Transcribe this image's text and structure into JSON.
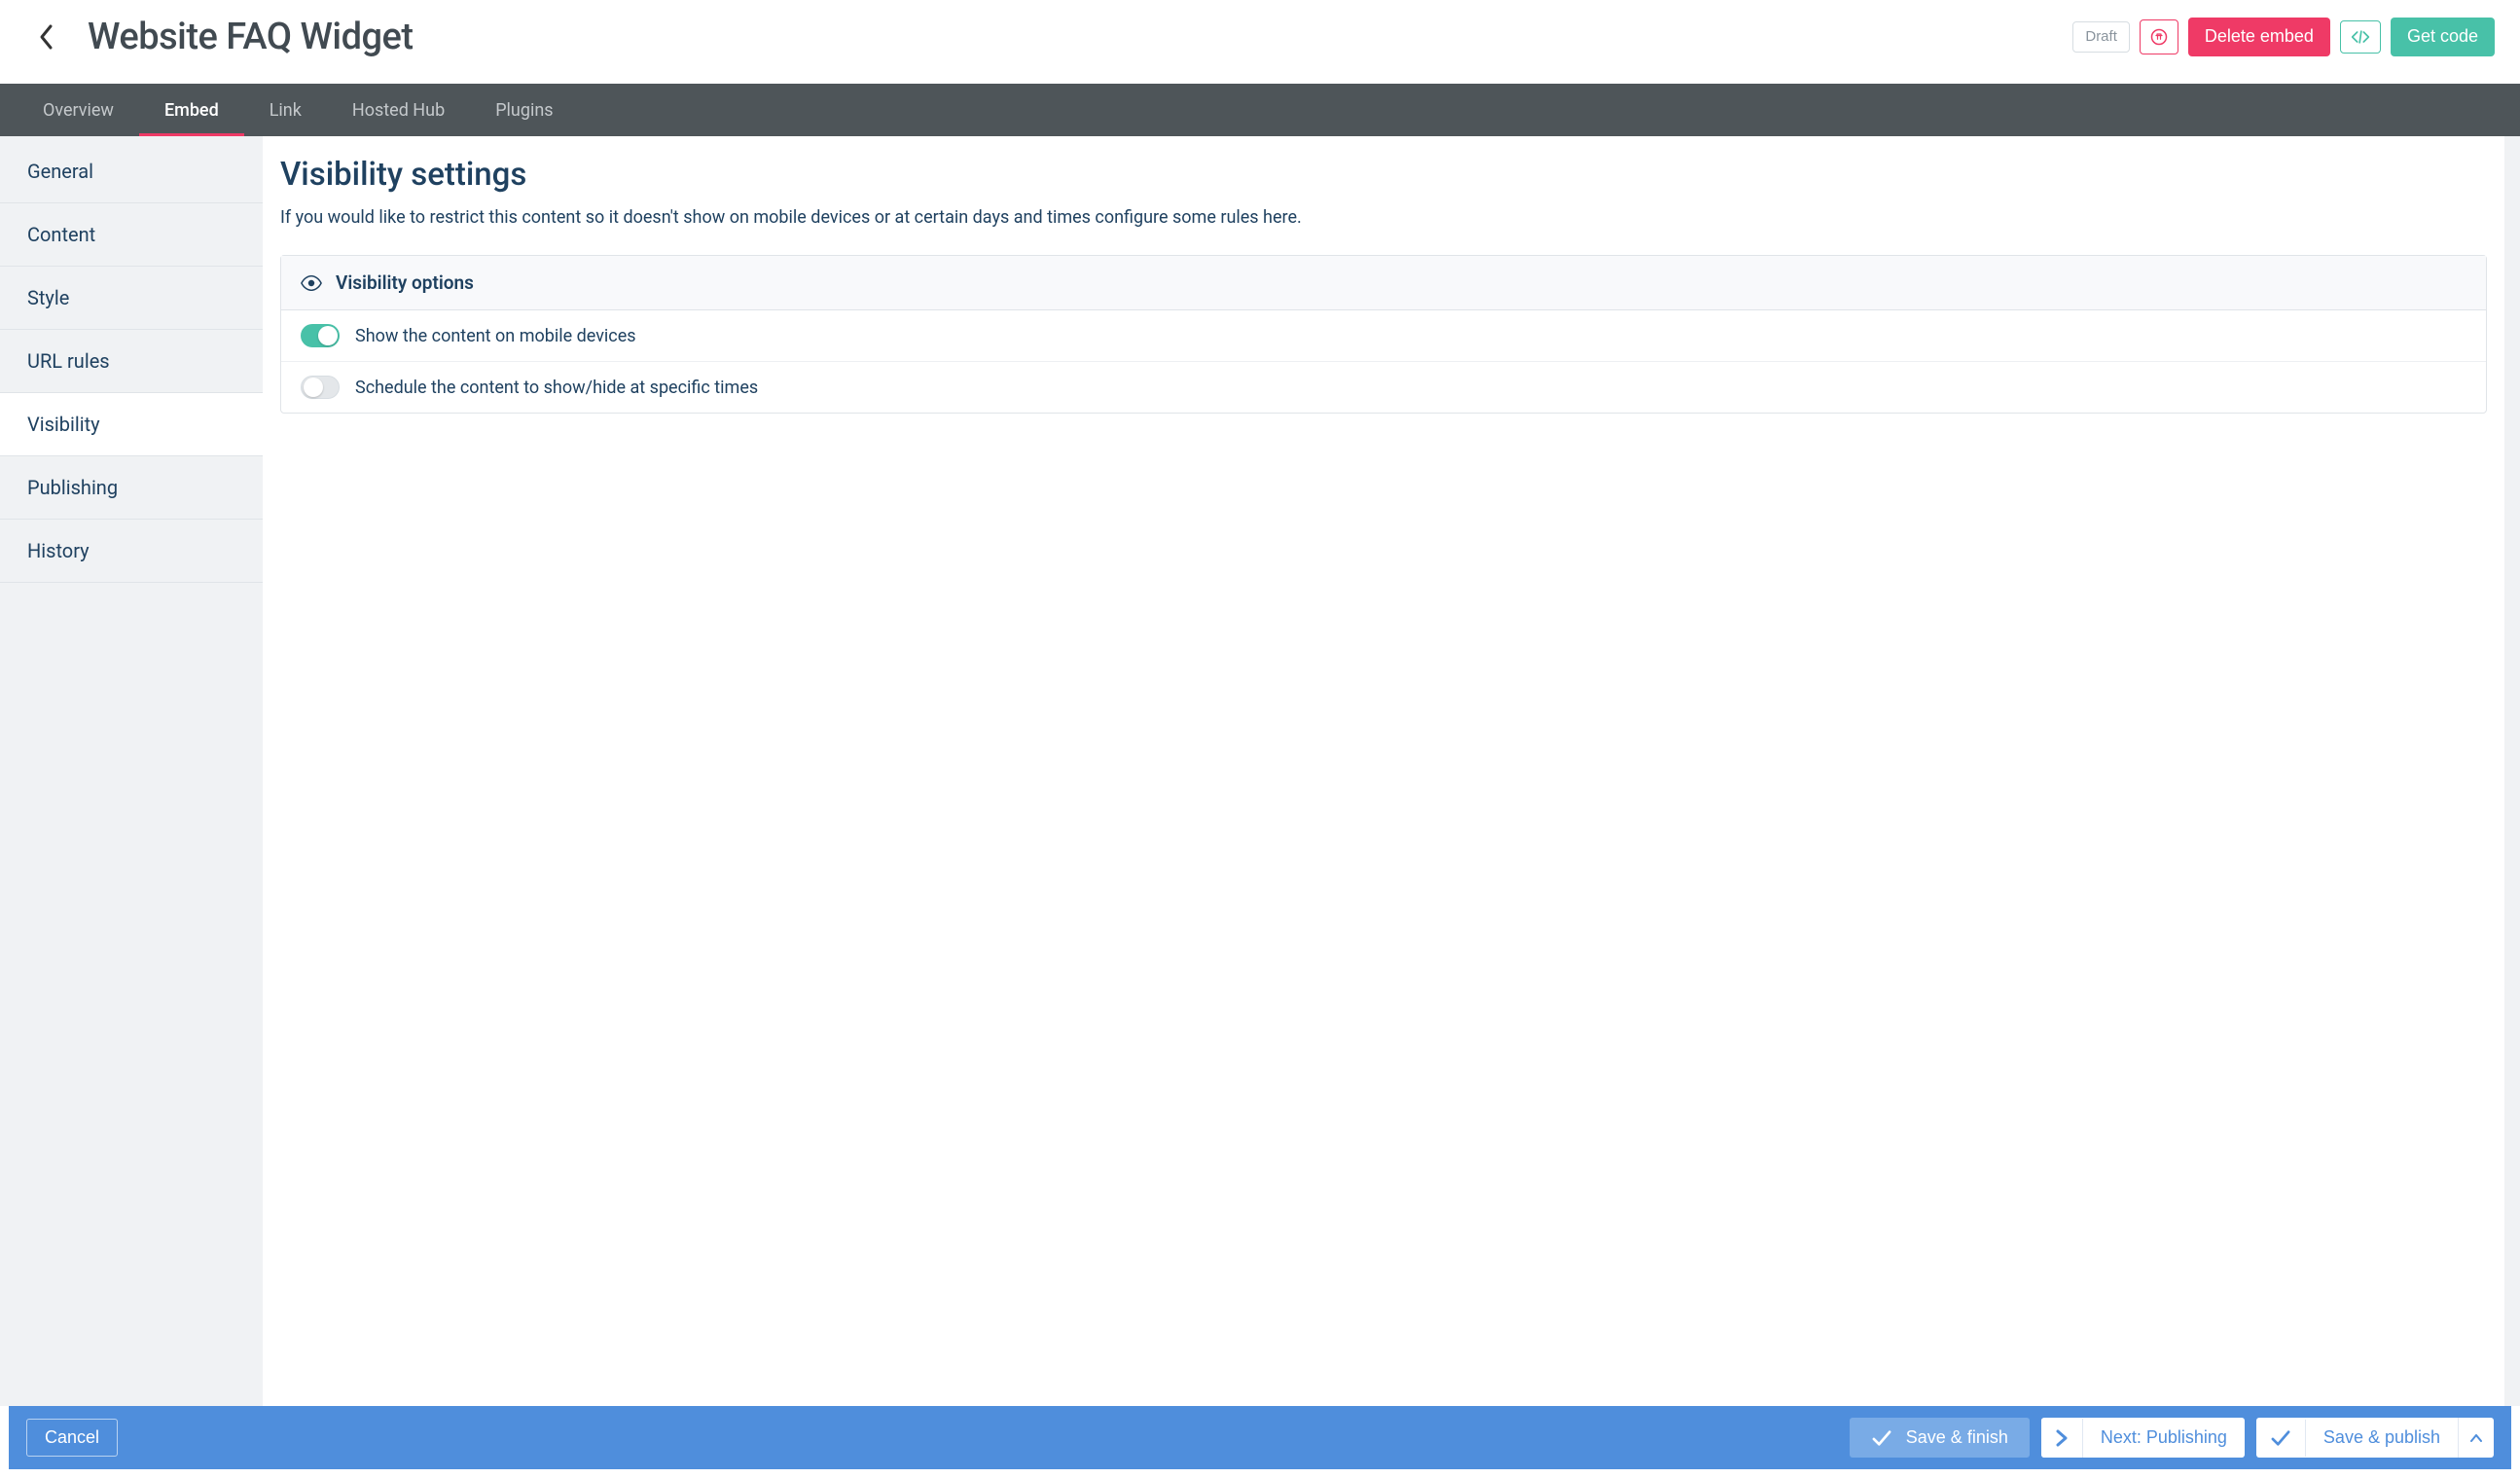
{
  "header": {
    "title": "Website FAQ Widget",
    "draft_label": "Draft",
    "delete_label": "Delete embed",
    "getcode_label": "Get code"
  },
  "nav": {
    "tabs": [
      {
        "label": "Overview"
      },
      {
        "label": "Embed"
      },
      {
        "label": "Link"
      },
      {
        "label": "Hosted Hub"
      },
      {
        "label": "Plugins"
      }
    ],
    "active_index": 1
  },
  "sidebar": {
    "items": [
      {
        "label": "General"
      },
      {
        "label": "Content"
      },
      {
        "label": "Style"
      },
      {
        "label": "URL rules"
      },
      {
        "label": "Visibility"
      },
      {
        "label": "Publishing"
      },
      {
        "label": "History"
      }
    ],
    "active_index": 4
  },
  "main": {
    "heading": "Visibility settings",
    "description": "If you would like to restrict this content so it doesn't show on mobile devices or at certain days and times configure some rules here.",
    "panel_title": "Visibility options",
    "option_mobile": "Show the content on mobile devices",
    "option_schedule": "Schedule the content to show/hide at specific times",
    "toggle_mobile_on": true,
    "toggle_schedule_on": false
  },
  "footer": {
    "cancel": "Cancel",
    "save_finish": "Save & finish",
    "next": "Next: Publishing",
    "save_publish": "Save & publish"
  }
}
